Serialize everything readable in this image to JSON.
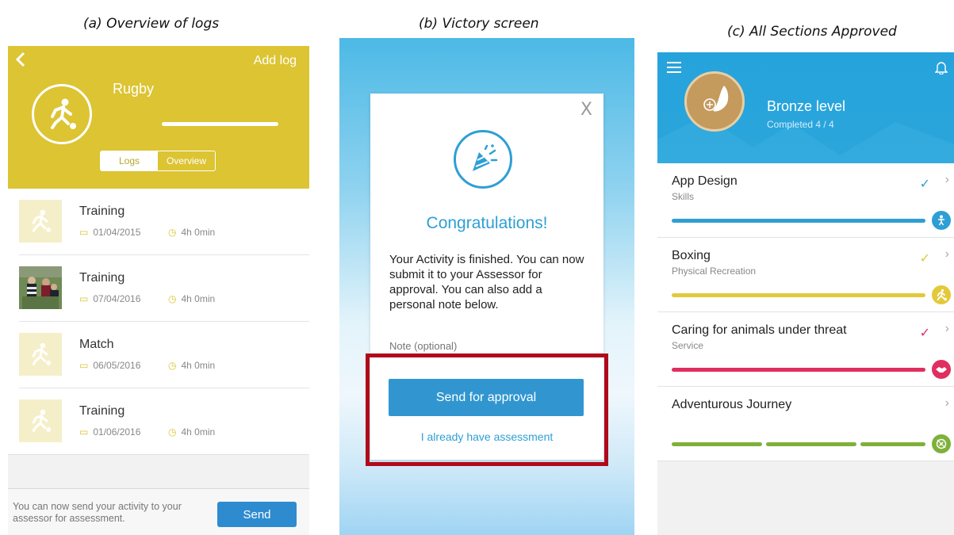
{
  "captions": {
    "a": "(a)    Overview of logs",
    "b": "(b) Victory screen",
    "c": "(c) All Sections Approved"
  },
  "overview": {
    "add_log": "Add log",
    "activity": "Rugby",
    "tabs": [
      "Logs",
      "Overview"
    ],
    "logs": [
      {
        "name": "Training",
        "date": "01/04/2015",
        "duration": "4h 0min",
        "thumb": "figure"
      },
      {
        "name": "Training",
        "date": "07/04/2016",
        "duration": "4h 0min",
        "thumb": "photo"
      },
      {
        "name": "Match",
        "date": "06/05/2016",
        "duration": "4h 0min",
        "thumb": "figure"
      },
      {
        "name": "Training",
        "date": "01/06/2016",
        "duration": "4h 0min",
        "thumb": "figure"
      }
    ],
    "footer_message": "You can now send your activity to your assessor for assessment.",
    "send_label": "Send",
    "colors": {
      "accent": "#dcc433",
      "button": "#2e8bd0"
    }
  },
  "victory": {
    "close": "X",
    "title": "Congratulations!",
    "body": "Your Activity is finished. You can now submit it to your Assessor for approval. You can also add a personal note below.",
    "note_placeholder": "Note (optional)",
    "approve_label": "Send for approval",
    "link_label": "I already have assessment",
    "colors": {
      "accent": "#2e9fd4",
      "highlight": "#b00a1a"
    }
  },
  "sections": {
    "level": "Bronze level",
    "completed": "Completed 4 / 4",
    "items": [
      {
        "name": "App Design",
        "sub": "Skills",
        "color": "#2e9fd4",
        "check": true,
        "segments": 1
      },
      {
        "name": "Boxing",
        "sub": "Physical Recreation",
        "color": "#e3c93a",
        "check": true,
        "segments": 1
      },
      {
        "name": "Caring for animals under threat",
        "sub": "Service",
        "color": "#e02e5f",
        "check": true,
        "segments": 1
      },
      {
        "name": "Adventurous Journey",
        "sub": "",
        "color": "#7fb13a",
        "check": false,
        "segments": 3
      }
    ]
  }
}
